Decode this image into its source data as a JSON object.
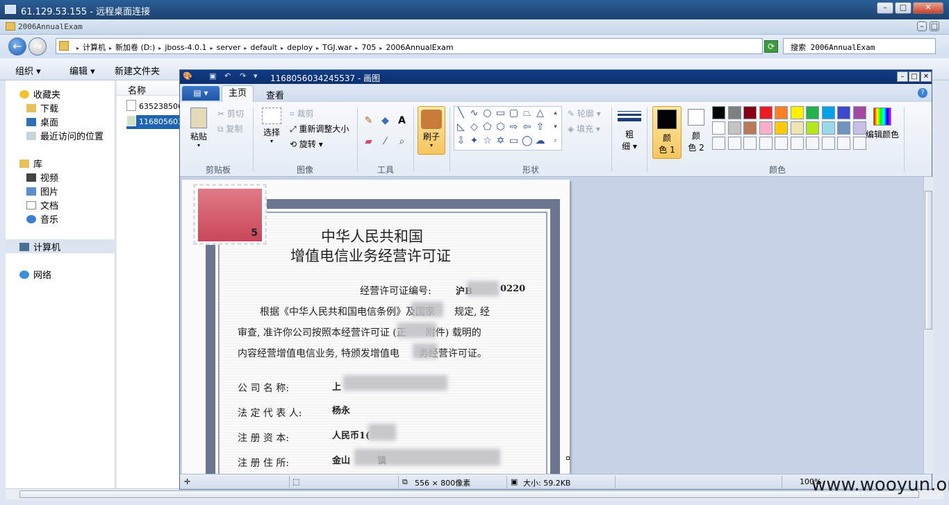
{
  "rdp": {
    "title": "61.129.53.155 - 远程桌面连接",
    "min": "–",
    "max": "□",
    "close": "✕"
  },
  "explorer": {
    "title": "2006AnnualExam",
    "min": "–",
    "max": "□",
    "breadcrumbs": [
      "计算机",
      "新加卷 (D:)",
      "jboss-4.0.1",
      "server",
      "default",
      "deploy",
      "TGJ.war",
      "705",
      "2006AnnualExam"
    ],
    "search_placeholder": "搜索 2006AnnualExam",
    "commands": {
      "organize": "组织 ▾",
      "edit": "编辑 ▾",
      "new_folder": "新建文件夹"
    },
    "nav": {
      "favorites": "收藏夹",
      "downloads": "下载",
      "desktop": "桌面",
      "recent": "最近访问的位置",
      "libraries": "库",
      "videos": "视频",
      "pictures": "图片",
      "documents": "文档",
      "music": "音乐",
      "computer": "计算机",
      "network": "网络"
    },
    "list_header": "名称",
    "files": [
      "635238506",
      "116805603"
    ]
  },
  "paint": {
    "title": "1168056034245537 - 画图",
    "tabs": {
      "file": "▤ ▾",
      "home": "主页",
      "view": "查看"
    },
    "clipboard": {
      "paste": "粘贴",
      "cut": "剪切",
      "copy": "复制",
      "label": "剪贴板"
    },
    "image": {
      "select": "选择",
      "crop": "裁剪",
      "resize": "重新调整大小",
      "rotate": "旋转",
      "label": "图像"
    },
    "tools": {
      "label": "工具"
    },
    "brush": {
      "label": "刷子"
    },
    "shapes": {
      "outline": "轮廓",
      "fill": "填充",
      "label": "形状"
    },
    "size": {
      "l1": "粗",
      "l2": "细"
    },
    "color1": {
      "l1": "颜",
      "l2": "色 1"
    },
    "color2": {
      "l1": "颜",
      "l2": "色 2"
    },
    "edit_colors": "编辑颜色",
    "colors_label": "颜色",
    "palette_row1": [
      "#000000",
      "#7f7f7f",
      "#880015",
      "#ed1c24",
      "#ff7f27",
      "#fff200",
      "#22b14c",
      "#00a2e8",
      "#3f48cc",
      "#a349a4"
    ],
    "palette_row2": [
      "#ffffff",
      "#c3c3c3",
      "#b97a57",
      "#ffaec9",
      "#ffc90e",
      "#efe4b0",
      "#b5e61d",
      "#99d9ea",
      "#7092be",
      "#c8bfe7"
    ],
    "status": {
      "dims": "556 × 800像素",
      "size": "大小: 59.2KB",
      "zoom": "100%"
    }
  },
  "document": {
    "title1": "中华人民共和国",
    "title2": "增值电信业务经营许可证",
    "license_no_label": "经营许可证编号:",
    "license_no_a": "沪B",
    "license_no_b": "0220",
    "para1": "根据《中华人民共和国电信条例》及国家　　规定, 经",
    "para2": "审查, 准许你公司按照本经营许可证 (正　　附件) 载明的",
    "para3": "内容经营增值电信业务, 特颁发增值电　　务经营许可证。",
    "company_label": "公 司 名 称:",
    "company_value": "上",
    "rep_label": "法 定 代 表 人:",
    "rep_value": "杨永",
    "capital_label": "注 册 资 本:",
    "capital_value": "人民币1(",
    "address_label": "注 册 住 所:",
    "address_value": "金山　　　镇",
    "stamp_value": "5"
  },
  "watermark": "www.wooyun.org"
}
